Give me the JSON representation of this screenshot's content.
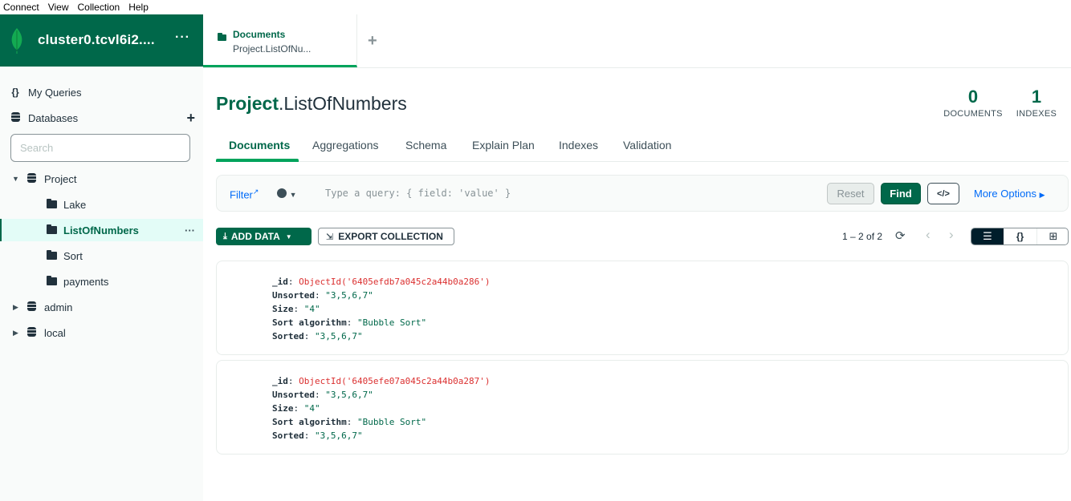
{
  "menu": [
    "Connect",
    "View",
    "Collection",
    "Help"
  ],
  "sidebar": {
    "cluster_name": "cluster0.tcvl6i2....",
    "menu_dots": "···",
    "my_queries": "My Queries",
    "databases": "Databases",
    "search_placeholder": "Search",
    "tree": [
      {
        "name": "Project",
        "type": "database",
        "expanded": true,
        "collections": [
          "Lake",
          "ListOfNumbers",
          "Sort",
          "payments"
        ],
        "selected": "ListOfNumbers"
      },
      {
        "name": "admin",
        "type": "database",
        "expanded": false
      },
      {
        "name": "local",
        "type": "database",
        "expanded": false
      }
    ],
    "selected_dots": "···"
  },
  "tab": {
    "title": "Documents",
    "subtitle": "Project.ListOfNu...",
    "add": "+"
  },
  "collection": {
    "db": "Project",
    "separator": ".",
    "name": "ListOfNumbers",
    "documents_count": "0",
    "documents_label": "DOCUMENTS",
    "indexes_count": "1",
    "indexes_label": "INDEXES"
  },
  "subtabs": [
    "Documents",
    "Aggregations",
    "Schema",
    "Explain Plan",
    "Indexes",
    "Validation"
  ],
  "query": {
    "filter_label": "Filter",
    "placeholder": "Type a query: { field: 'value' }",
    "reset": "Reset",
    "find": "Find",
    "code": "</>",
    "more_options": "More Options"
  },
  "toolbar": {
    "add_data": "ADD DATA",
    "export": "EXPORT COLLECTION",
    "pager": "1 – 2 of 2"
  },
  "documents": [
    {
      "_id": "ObjectId('6405efdb7a045c2a44b0a286')",
      "Unsorted": "\"3,5,6,7\"",
      "Size": "\"4\"",
      "Sort algorithm": "\"Bubble Sort\"",
      "Sorted": "\"3,5,6,7\""
    },
    {
      "_id": "ObjectId('6405efe07a045c2a44b0a287')",
      "Unsorted": "\"3,5,6,7\"",
      "Size": "\"4\"",
      "Sort algorithm": "\"Bubble Sort\"",
      "Sorted": "\"3,5,6,7\""
    }
  ],
  "colors": {
    "brand": "#00684a",
    "accent": "#00a35c",
    "link": "#016bf8",
    "oid": "#db3030"
  },
  "icons": [
    "leaf-logo-icon",
    "braces-icon",
    "database-icon",
    "plus-icon",
    "folder-icon",
    "caret-down-icon",
    "caret-right-icon",
    "external-link-icon",
    "clock-icon",
    "code-icon",
    "download-icon",
    "export-icon",
    "refresh-icon",
    "chevron-left-icon",
    "chevron-right-icon",
    "list-view-icon",
    "json-view-icon",
    "table-view-icon"
  ]
}
